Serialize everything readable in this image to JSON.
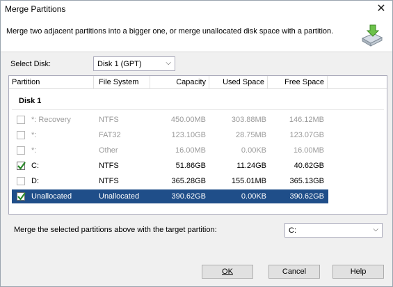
{
  "window": {
    "title": "Merge Partitions"
  },
  "banner": {
    "text": "Merge two adjacent partitions into a bigger one, or merge unallocated disk space with a partition."
  },
  "disk_select": {
    "label": "Select Disk:",
    "value": "Disk 1 (GPT)"
  },
  "table": {
    "headers": [
      "Partition",
      "File System",
      "Capacity",
      "Used Space",
      "Free Space"
    ],
    "group": "Disk 1",
    "rows": [
      {
        "partition": "*: Recovery",
        "fs": "NTFS",
        "capacity": "450.00MB",
        "used": "303.88MB",
        "free": "146.12MB",
        "checked": false,
        "state": "disabled"
      },
      {
        "partition": "*:",
        "fs": "FAT32",
        "capacity": "123.10GB",
        "used": "28.75MB",
        "free": "123.07GB",
        "checked": false,
        "state": "disabled"
      },
      {
        "partition": "*:",
        "fs": "Other",
        "capacity": "16.00MB",
        "used": "0.00KB",
        "free": "16.00MB",
        "checked": false,
        "state": "disabled"
      },
      {
        "partition": "C:",
        "fs": "NTFS",
        "capacity": "51.86GB",
        "used": "11.24GB",
        "free": "40.62GB",
        "checked": true,
        "state": "normal"
      },
      {
        "partition": "D:",
        "fs": "NTFS",
        "capacity": "365.28GB",
        "used": "155.01MB",
        "free": "365.13GB",
        "checked": false,
        "state": "normal"
      },
      {
        "partition": "Unallocated",
        "fs": "Unallocated",
        "capacity": "390.62GB",
        "used": "0.00KB",
        "free": "390.62GB",
        "checked": true,
        "state": "selected"
      }
    ]
  },
  "target": {
    "label": "Merge the selected partitions above with the target partition:",
    "value": "C:"
  },
  "buttons": {
    "ok": "OK",
    "cancel": "Cancel",
    "help": "Help"
  },
  "colors": {
    "selection": "#1f4e89",
    "checkmark": "#2a8a2a"
  }
}
